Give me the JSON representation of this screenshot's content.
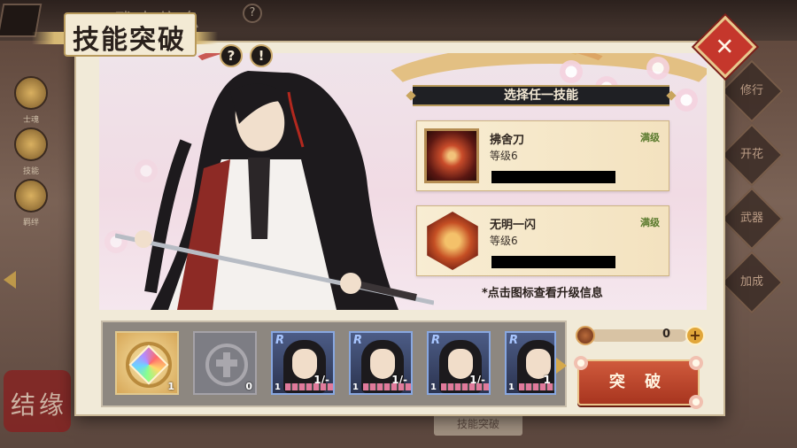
{
  "background": {
    "header_title": "武士信息",
    "help_icon": "?",
    "left_menu": [
      "士魂",
      "技能",
      "羁绊"
    ],
    "right_menu": [
      "修行",
      "开花",
      "武器",
      "加成"
    ],
    "seal_text": "结缘",
    "bottom_button": "技能突破"
  },
  "dialog": {
    "title": "技能突破",
    "help_icon": "?",
    "info_icon": "!",
    "close_icon": "✕",
    "skill_section_title": "选择任一技能",
    "skills": [
      {
        "name": "拂舍刀",
        "level": "等级6",
        "status": "满级"
      },
      {
        "name": "无明一闪",
        "level": "等级6",
        "status": "满级"
      }
    ],
    "hint": "*点击图标查看升级信息",
    "items": [
      {
        "type": "material-gold",
        "count": "1"
      },
      {
        "type": "material-grey",
        "count": "0"
      },
      {
        "type": "card",
        "rarity": "R",
        "level": "1",
        "fraction": "1/-"
      },
      {
        "type": "card",
        "rarity": "R",
        "level": "1",
        "fraction": "1/-"
      },
      {
        "type": "card",
        "rarity": "R",
        "level": "1",
        "fraction": "1/-"
      },
      {
        "type": "card",
        "rarity": "R",
        "level": "1",
        "fraction": "1"
      }
    ],
    "currency": {
      "value": "0",
      "plus": "+"
    },
    "break_button": "突 破"
  },
  "colors": {
    "accent_red": "#c5372c",
    "gold": "#d7a85b",
    "panel": "#f1ead8",
    "max_level_green": "#5a7a2d"
  }
}
